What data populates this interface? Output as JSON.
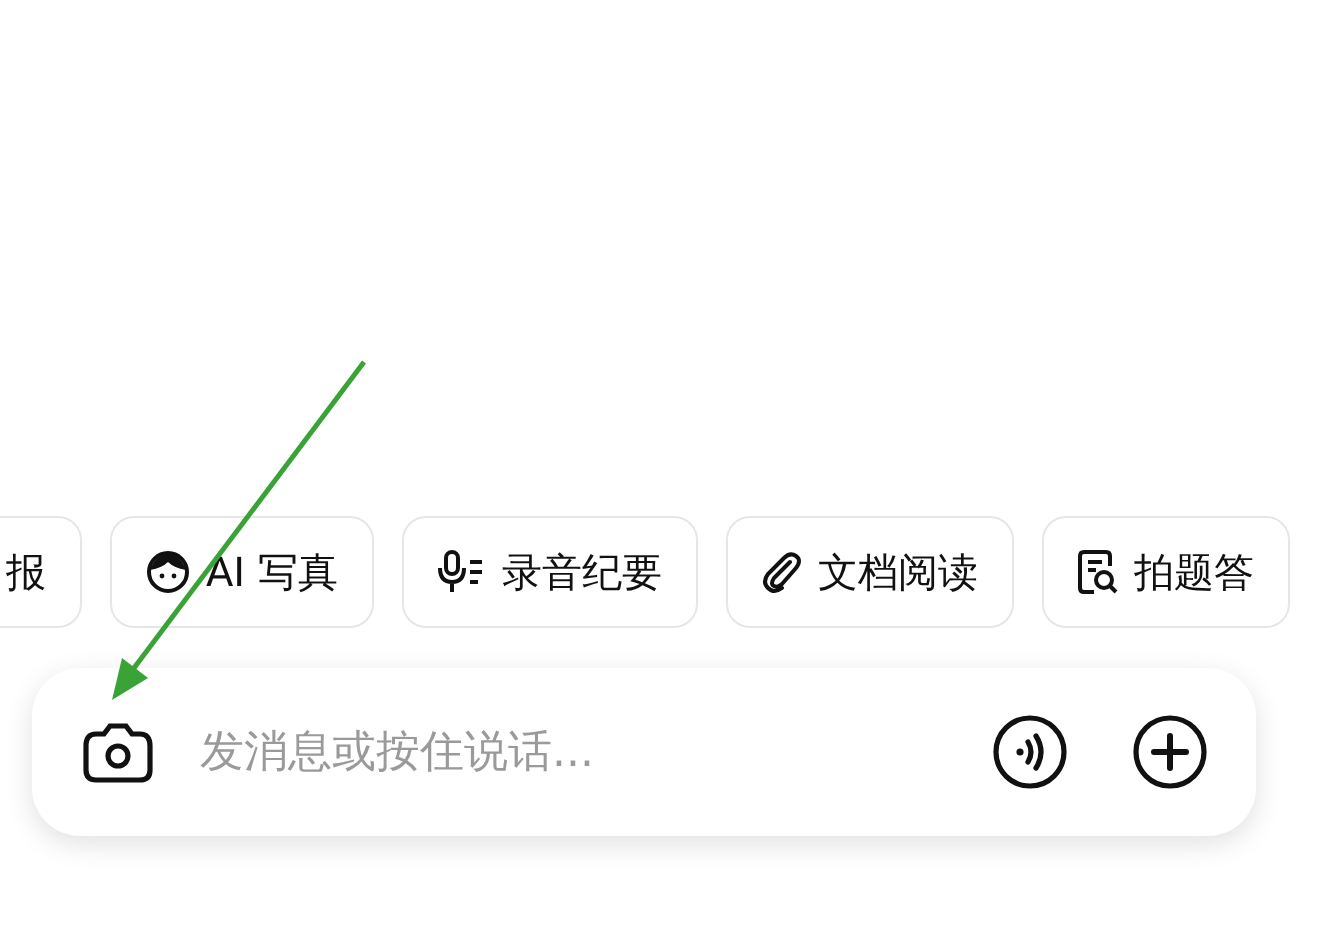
{
  "quick_actions": [
    {
      "label": "报",
      "kind": "plain"
    },
    {
      "label": "AI 写真",
      "kind": "face"
    },
    {
      "label": "录音纪要",
      "kind": "mic"
    },
    {
      "label": "文档阅读",
      "kind": "clip"
    },
    {
      "label": "拍题答",
      "kind": "doc-search"
    }
  ],
  "composer": {
    "placeholder": "发消息或按住说话..."
  }
}
